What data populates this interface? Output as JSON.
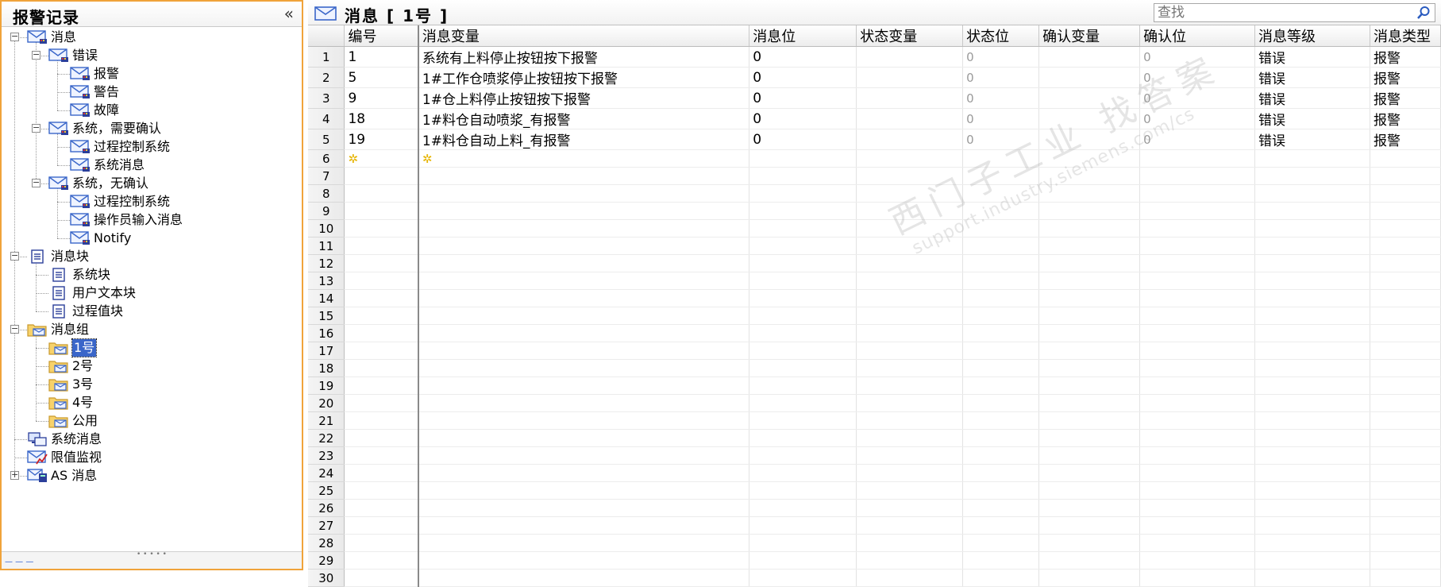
{
  "left_panel": {
    "title": "报警记录",
    "collapse_glyph": "«",
    "tree": [
      {
        "id": "n-msg",
        "label": "消息",
        "level": 0,
        "icon": "message-envelope-icon",
        "expander": "minus"
      },
      {
        "id": "n-err",
        "label": "错误",
        "level": 1,
        "icon": "message-envelope-icon",
        "expander": "minus"
      },
      {
        "id": "n-alarm",
        "label": "报警",
        "level": 2,
        "icon": "message-envelope-icon"
      },
      {
        "id": "n-warn",
        "label": "警告",
        "level": 2,
        "icon": "message-envelope-icon"
      },
      {
        "id": "n-fault",
        "label": "故障",
        "level": 2,
        "icon": "message-envelope-icon"
      },
      {
        "id": "n-sys-ack",
        "label": "系统，需要确认",
        "level": 1,
        "icon": "message-envelope-icon",
        "expander": "minus"
      },
      {
        "id": "n-pcs1",
        "label": "过程控制系统",
        "level": 2,
        "icon": "message-envelope-icon"
      },
      {
        "id": "n-sysmsg1",
        "label": "系统消息",
        "level": 2,
        "icon": "message-envelope-icon"
      },
      {
        "id": "n-sys-noack",
        "label": "系统，无确认",
        "level": 1,
        "icon": "message-envelope-icon",
        "expander": "minus"
      },
      {
        "id": "n-pcs2",
        "label": "过程控制系统",
        "level": 2,
        "icon": "message-envelope-icon"
      },
      {
        "id": "n-operator",
        "label": "操作员输入消息",
        "level": 2,
        "icon": "message-envelope-icon"
      },
      {
        "id": "n-notify",
        "label": "Notify",
        "level": 2,
        "icon": "message-envelope-icon"
      },
      {
        "id": "n-blocks",
        "label": "消息块",
        "level": 0,
        "icon": "document-block-icon",
        "expander": "minus"
      },
      {
        "id": "n-sysblock",
        "label": "系统块",
        "level": 1,
        "icon": "document-block-icon"
      },
      {
        "id": "n-usertext",
        "label": "用户文本块",
        "level": 1,
        "icon": "document-block-icon"
      },
      {
        "id": "n-procval",
        "label": "过程值块",
        "level": 1,
        "icon": "document-block-icon"
      },
      {
        "id": "n-groups",
        "label": "消息组",
        "level": 0,
        "icon": "folder-envelope-icon",
        "expander": "minus"
      },
      {
        "id": "n-g1",
        "label": "1号",
        "level": 1,
        "icon": "folder-envelope-icon",
        "selected": true
      },
      {
        "id": "n-g2",
        "label": "2号",
        "level": 1,
        "icon": "folder-envelope-icon"
      },
      {
        "id": "n-g3",
        "label": "3号",
        "level": 1,
        "icon": "folder-envelope-icon"
      },
      {
        "id": "n-g4",
        "label": "4号",
        "level": 1,
        "icon": "folder-envelope-icon"
      },
      {
        "id": "n-public",
        "label": "公用",
        "level": 1,
        "icon": "folder-envelope-icon"
      },
      {
        "id": "n-sysmsgs",
        "label": "系统消息",
        "level": 0,
        "icon": "computer-icon"
      },
      {
        "id": "n-limit",
        "label": "限值监视",
        "level": 0,
        "icon": "limit-monitor-icon"
      },
      {
        "id": "n-as",
        "label": "AS 消息",
        "level": 0,
        "icon": "as-message-icon",
        "expander": "plus"
      }
    ]
  },
  "right_panel": {
    "title": "消息  [  1号  ]",
    "search_placeholder": "查找",
    "columns": [
      "编号",
      "消息变量",
      "消息位",
      "状态变量",
      "状态位",
      "确认变量",
      "确认位",
      "消息等级",
      "消息类型"
    ],
    "rows": [
      {
        "num": "1",
        "id": "1",
        "var": "系统有上料停止按钮按下报警",
        "bit": "0",
        "state_var": "",
        "state_bit": "0",
        "ack_var": "",
        "ack_bit": "0",
        "level": "错误",
        "type": "报警"
      },
      {
        "num": "2",
        "id": "5",
        "var": "1#工作仓喷浆停止按钮按下报警",
        "bit": "0",
        "state_var": "",
        "state_bit": "0",
        "ack_var": "",
        "ack_bit": "0",
        "level": "错误",
        "type": "报警"
      },
      {
        "num": "3",
        "id": "9",
        "var": "1#仓上料停止按钮按下报警",
        "bit": "0",
        "state_var": "",
        "state_bit": "0",
        "ack_var": "",
        "ack_bit": "0",
        "level": "错误",
        "type": "报警"
      },
      {
        "num": "4",
        "id": "18",
        "var": "1#料仓自动喷浆_有报警",
        "bit": "0",
        "state_var": "",
        "state_bit": "0",
        "ack_var": "",
        "ack_bit": "0",
        "level": "错误",
        "type": "报警"
      },
      {
        "num": "5",
        "id": "19",
        "var": "1#料仓自动上料_有报警",
        "bit": "0",
        "state_var": "",
        "state_bit": "0",
        "ack_var": "",
        "ack_bit": "0",
        "level": "错误",
        "type": "报警"
      }
    ],
    "new_row_num": "6",
    "new_row_marker": "✲",
    "empty_row_nums": [
      "7",
      "8",
      "9",
      "10",
      "11",
      "12",
      "13",
      "14",
      "15",
      "16",
      "17",
      "18",
      "19",
      "20",
      "21",
      "22",
      "23",
      "24",
      "25",
      "26",
      "27",
      "28",
      "29",
      "30"
    ]
  },
  "watermark": {
    "line1": "西门子工业  找答案",
    "line2": "support.industry.siemens.com/cs"
  },
  "colors": {
    "accent": "#f0a33a",
    "selection": "#3a66c9",
    "envelope": "#3a66c9"
  }
}
